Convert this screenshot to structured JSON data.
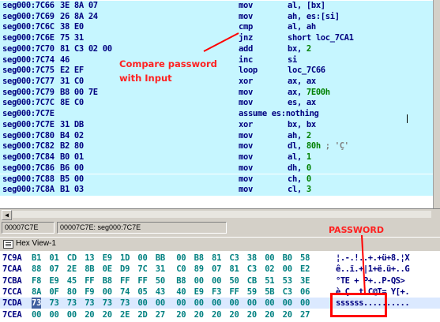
{
  "disassembly": {
    "lines": [
      {
        "addr": "seg000:7C66",
        "bytes": "3E 8A 07",
        "mnem": "mov",
        "ops": "al, [bx]",
        "style": "hl"
      },
      {
        "addr": "seg000:7C69",
        "bytes": "26 8A 24",
        "mnem": "mov",
        "ops": "ah, es:[si]",
        "style": "hl"
      },
      {
        "addr": "seg000:7C6C",
        "bytes": "38 E0",
        "mnem": "cmp",
        "ops": "al, ah",
        "style": "hl"
      },
      {
        "addr": "seg000:7C6E",
        "bytes": "75 31",
        "mnem": "jnz",
        "ops": "short loc_7CA1",
        "style": "hl"
      },
      {
        "addr": "seg000:7C70",
        "bytes": "81 C3 02 00",
        "mnem": "add",
        "ops": "bx, ",
        "num": "2",
        "style": "hl"
      },
      {
        "addr": "seg000:7C74",
        "bytes": "46",
        "mnem": "inc",
        "ops": "si",
        "style": "hl"
      },
      {
        "addr": "seg000:7C75",
        "bytes": "E2 EF",
        "mnem": "loop",
        "ops": "loc_7C66",
        "style": "hl"
      },
      {
        "addr": "seg000:7C77",
        "bytes": "31 C0",
        "mnem": "xor",
        "ops": "ax, ax",
        "style": "hl"
      },
      {
        "addr": "seg000:7C79",
        "bytes": "B8 00 7E",
        "mnem": "mov",
        "ops": "ax, ",
        "num": "7E00h",
        "style": "hl"
      },
      {
        "addr": "seg000:7C7C",
        "bytes": "8E C0",
        "mnem": "mov",
        "ops": "es, ax",
        "style": "hl"
      },
      {
        "addr": "seg000:7C7E",
        "bytes": "",
        "mnem": "assume es:nothing",
        "ops": "",
        "style": "sel"
      },
      {
        "addr": "seg000:7C7E",
        "bytes": "31 DB",
        "mnem": "xor",
        "ops": "bx, bx",
        "style": "hl"
      },
      {
        "addr": "seg000:7C80",
        "bytes": "B4 02",
        "mnem": "mov",
        "ops": "ah, ",
        "num": "2",
        "style": "hl"
      },
      {
        "addr": "seg000:7C82",
        "bytes": "B2 80",
        "mnem": "mov",
        "ops": "dl, ",
        "num": "80h",
        "str": " ; 'Ç'",
        "style": "hl"
      },
      {
        "addr": "seg000:7C84",
        "bytes": "B0 01",
        "mnem": "mov",
        "ops": "al, ",
        "num": "1",
        "style": "hl"
      },
      {
        "addr": "seg000:7C86",
        "bytes": "B6 00",
        "mnem": "mov",
        "ops": "dh, ",
        "num": "0",
        "style": "hl"
      },
      {
        "addr": "seg000:7C88",
        "bytes": "B5 00",
        "mnem": "mov",
        "ops": "ch, ",
        "num": "0",
        "style": "hl"
      },
      {
        "addr": "seg000:7C8A",
        "bytes": "B1 03",
        "mnem": "mov",
        "ops": "cl, ",
        "num": "3",
        "style": "hl"
      }
    ]
  },
  "annotations": {
    "compare_line1": "Compare password",
    "compare_line2": "with Input",
    "password_label": "PASSWORD"
  },
  "status": {
    "offset": "00007C7E",
    "location": "00007C7E: seg000:7C7E"
  },
  "hexview": {
    "title": "Hex View-1",
    "rows": [
      {
        "addr": "7C9A",
        "bytes": [
          "B1",
          "01",
          "CD",
          "13",
          "E9",
          "1D",
          "00",
          "BB",
          "00",
          "B8",
          "81",
          "C3",
          "38",
          "00",
          "B0",
          "58"
        ],
        "ascii": "¦.-.!..+.+ü+8.¦X"
      },
      {
        "addr": "7CAA",
        "bytes": [
          "88",
          "07",
          "2E",
          "8B",
          "0E",
          "D9",
          "7C",
          "31",
          "C0",
          "89",
          "07",
          "81",
          "C3",
          "02",
          "00",
          "E2"
        ],
        "ascii": "ê..ï.+|1+ë.ü+..G"
      },
      {
        "addr": "7CBA",
        "bytes": [
          "F8",
          "E9",
          "45",
          "FF",
          "B8",
          "FF",
          "FF",
          "50",
          "B8",
          "00",
          "00",
          "50",
          "CB",
          "51",
          "53",
          "3E"
        ],
        "ascii": "°TE + P+..P-QS>"
      },
      {
        "addr": "7CCA",
        "bytes": [
          "8A",
          "0F",
          "80",
          "F9",
          "00",
          "74",
          "05",
          "43",
          "40",
          "E9",
          "F3",
          "FF",
          "59",
          "5B",
          "C3",
          "06"
        ],
        "ascii": "è.Ç..t.C@T= Y[+."
      },
      {
        "addr": "7CDA",
        "bytes": [
          "73",
          "73",
          "73",
          "73",
          "73",
          "73",
          "00",
          "00",
          "00",
          "00",
          "00",
          "00",
          "00",
          "00",
          "00",
          "00"
        ],
        "ascii": "ssssss.........."
      },
      {
        "addr": "7CEA",
        "bytes": [
          "00",
          "00",
          "00",
          "20",
          "20",
          "2E",
          "2D",
          "27",
          "20",
          "20",
          "20",
          "20",
          "20",
          "20",
          "20",
          "27"
        ],
        "ascii": "..."
      }
    ]
  }
}
